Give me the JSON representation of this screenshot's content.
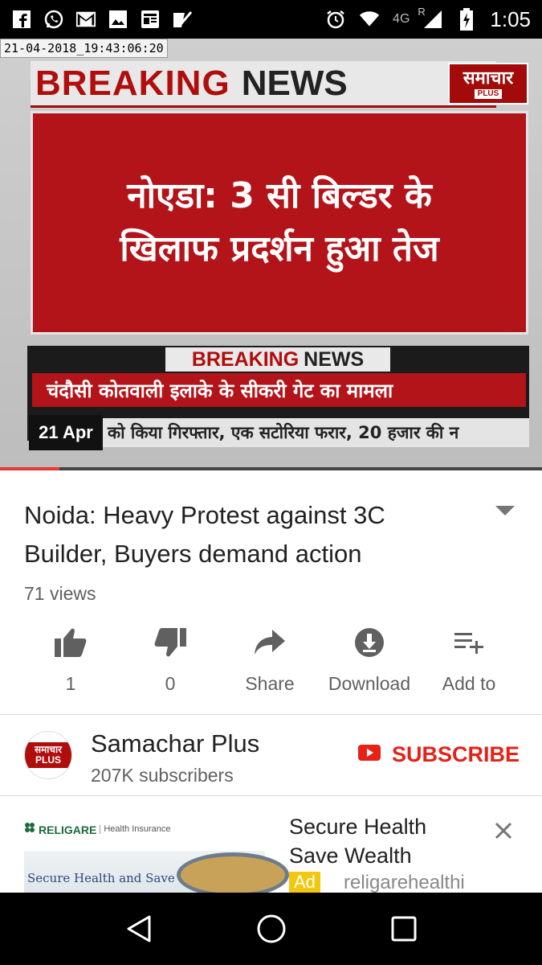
{
  "status_bar": {
    "network": "4G",
    "roaming": "R",
    "time": "1:05",
    "icons_left": [
      "facebook-icon",
      "whatsapp-icon",
      "gmail-icon",
      "gallery-icon",
      "news-icon",
      "tasks-icon"
    ],
    "icons_right": [
      "alarm-icon",
      "wifi-icon",
      "signal-icon",
      "battery-charging-icon"
    ]
  },
  "video": {
    "timestamp": "21-04-2018_19:43:06:20",
    "breaking_word1": "BREAKING",
    "breaking_word2": "NEWS",
    "channel_logo_text": "समाचार",
    "channel_logo_sub": "PLUS",
    "headline_line1": "नोएडा: 3 सी बिल्डर के",
    "headline_line2": "खिलाफ प्रदर्शन हुआ तेज",
    "ticker_label_word1": "BREAKING",
    "ticker_label_word2": "NEWS",
    "ticker_line1": "चंदौसी कोतवाली इलाके के सीकरी गेट का मामला",
    "ticker_date": "21 Apr",
    "ticker_line2": "को किया गिरफ्तार, एक सटोरिया फरार, 20 हजार की न",
    "progress_fraction": 0.11
  },
  "info": {
    "title": "Noida: Heavy Protest against 3C Builder, Buyers demand action",
    "views": "71 views",
    "actions": [
      {
        "id": "like",
        "label": "1"
      },
      {
        "id": "dislike",
        "label": "0"
      },
      {
        "id": "share",
        "label": "Share"
      },
      {
        "id": "download",
        "label": "Download"
      },
      {
        "id": "add",
        "label": "Add to"
      }
    ]
  },
  "channel": {
    "name": "Samachar Plus",
    "subscribers": "207K subscribers",
    "avatar_text": "समाचार PLUS",
    "subscribe_label": "SUBSCRIBE"
  },
  "ad": {
    "brand": "RELIGARE",
    "brand_tagline": "Health Insurance",
    "banner_text": "Secure Health and Save",
    "title": "Secure Health Save Wealth",
    "badge": "Ad",
    "url": "religarehealthi"
  },
  "colors": {
    "accent_red": "#e62117",
    "news_red": "#b3141a",
    "progress": "#e53935"
  }
}
